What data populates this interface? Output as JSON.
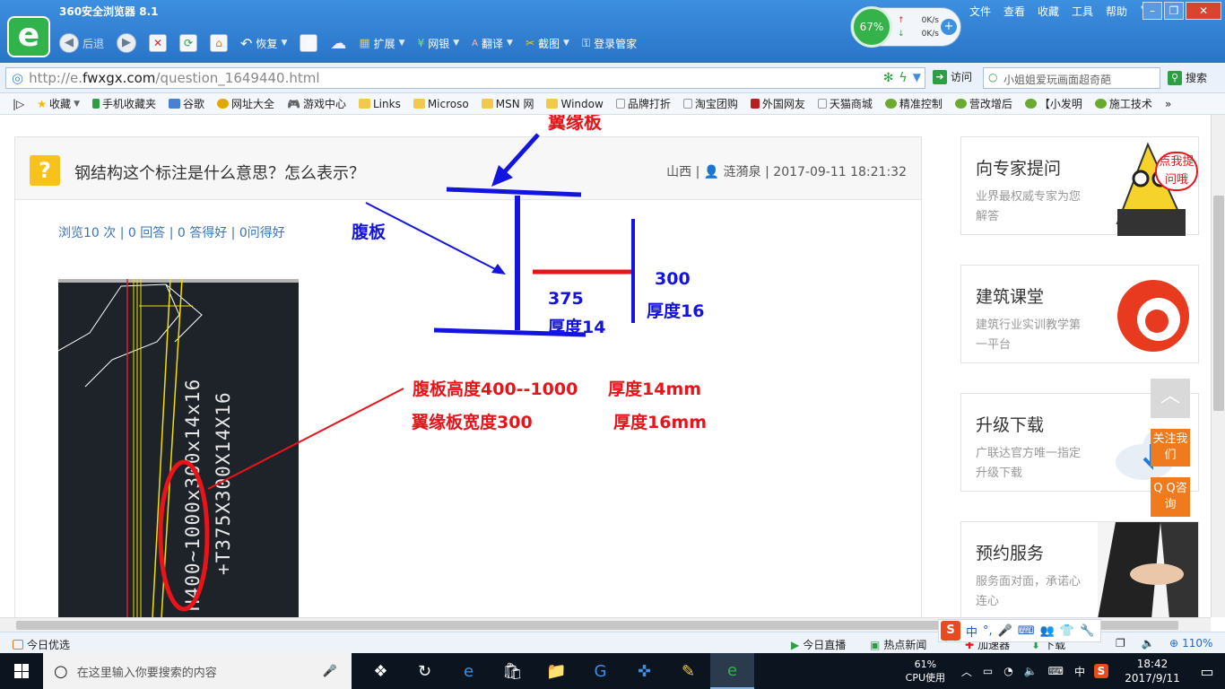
{
  "browser": {
    "title": "360安全浏览器 8.1",
    "logo_letter": "e",
    "nav": {
      "back": "后退",
      "restore": "恢复",
      "extend": "扩展",
      "netbank": "网银",
      "translate": "翻译",
      "screenshot": "截图",
      "login_manager": "登录管家"
    },
    "menu": [
      "文件",
      "查看",
      "收藏",
      "工具",
      "帮助"
    ],
    "perf": {
      "cpu_ring": "67%",
      "up": "0K/s",
      "down": "0K/s"
    },
    "address": {
      "prefix": "http://e.",
      "domain": "fwxgx.com",
      "path": "/question_1649440.html"
    },
    "visit_label": "访问",
    "search_placeholder": "小姐姐爱玩画面超奇葩",
    "search_label": "搜索",
    "bookmarks": [
      "收藏",
      "手机收藏夹",
      "谷歌",
      "网址大全",
      "游戏中心",
      "Links",
      "Microso",
      "MSN 网",
      "Window",
      "品牌打折",
      "淘宝团购",
      "外国网友",
      "天猫商城",
      "精准控制",
      "营改增后",
      "【小发明",
      "施工技术"
    ]
  },
  "question": {
    "title": "钢结构这个标注是什么意思？怎么表示？",
    "region": "山西",
    "author": "涟漪泉",
    "datetime": "2017-09-11 18:21:32",
    "stats": "浏览10 次 | 0 回答 | 0 答得好 | 0问得好",
    "cad_line1": "H400~1000x300x14x16",
    "cad_line2": "+T375X300X14X16"
  },
  "annotations": {
    "flange": "翼缘板",
    "web": "腹板",
    "dim_375": "375",
    "thk_14": "厚度14",
    "dim_300": "300",
    "thk_16": "厚度16",
    "web_height": "腹板高度400--1000",
    "thk_14mm": "厚度14mm",
    "flange_width": "翼缘板宽度300",
    "thk_16mm": "厚度16mm"
  },
  "sidebar_ads": [
    {
      "title": "向专家提问",
      "desc": "业界最权威专家为您解答",
      "badge": "点我提问哦"
    },
    {
      "title": "建筑课堂",
      "desc": "建筑行业实训教学第一平台"
    },
    {
      "title": "升级下载",
      "desc": "广联达官方唯一指定升级下载"
    },
    {
      "title": "预约服务",
      "desc": "服务面对面，承诺心连心"
    }
  ],
  "float_buttons": {
    "follow": "关注我们",
    "qq": "Q Q咨询"
  },
  "statusbar": {
    "left": "今日优选",
    "live": "今日直播",
    "hot_news": "热点新闻",
    "accelerator": "加速器",
    "download": "下载",
    "zoom": "110%"
  },
  "ime": {
    "lang": "中"
  },
  "taskbar": {
    "search_placeholder": "在这里输入你要搜索的内容",
    "cpu_value": "61%",
    "cpu_label": "CPU使用",
    "ime_lang": "中",
    "time": "18:42",
    "date": "2017/9/11"
  },
  "colors": {
    "annotation_red": "#e8141a",
    "annotation_blue": "#1414e0",
    "brand_green": "#2fb34a",
    "link_blue": "#3a73b8"
  }
}
